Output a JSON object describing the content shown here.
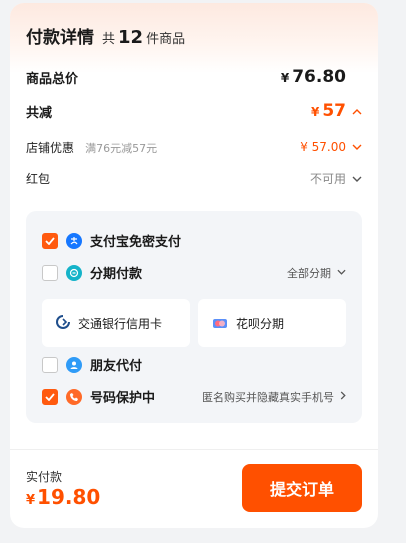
{
  "header": {
    "title": "付款详情",
    "count_prefix": "共",
    "count": "12",
    "count_suffix": "件商品"
  },
  "summary": {
    "total_label": "商品总价",
    "total_currency": "¥",
    "total_value": "76.80",
    "discount_label": "共减",
    "discount_currency": "¥",
    "discount_value": "57",
    "shop_discount_label": "店铺优惠",
    "shop_discount_note": "满76元减57元",
    "shop_discount_value": "¥ 57.00",
    "redpack_label": "红包",
    "redpack_value": "不可用"
  },
  "payment": {
    "options": [
      {
        "name": "支付宝免密支付",
        "checked": true,
        "icon": "alipay-icon",
        "color": "#1677ff"
      },
      {
        "name": "分期付款",
        "checked": false,
        "icon": "installment-icon",
        "color": "#15b3c9",
        "extra": "全部分期"
      },
      {
        "name": "朋友代付",
        "checked": false,
        "icon": "friend-pay-icon",
        "color": "#2f9bf7"
      },
      {
        "name": "号码保护中",
        "checked": true,
        "icon": "phone-protect-icon",
        "color": "#ff6a28",
        "extra": "匿名购买并隐藏真实手机号"
      }
    ],
    "installment_cards": [
      {
        "name": "交通银行信用卡",
        "icon": "bocom-icon"
      },
      {
        "name": "花呗分期",
        "icon": "huabei-icon"
      }
    ]
  },
  "footer": {
    "pay_label": "实付款",
    "pay_currency": "¥",
    "pay_value": "19.80",
    "submit_label": "提交订单"
  },
  "colors": {
    "accent": "#ff5000",
    "panel": "#f3f5f8"
  }
}
